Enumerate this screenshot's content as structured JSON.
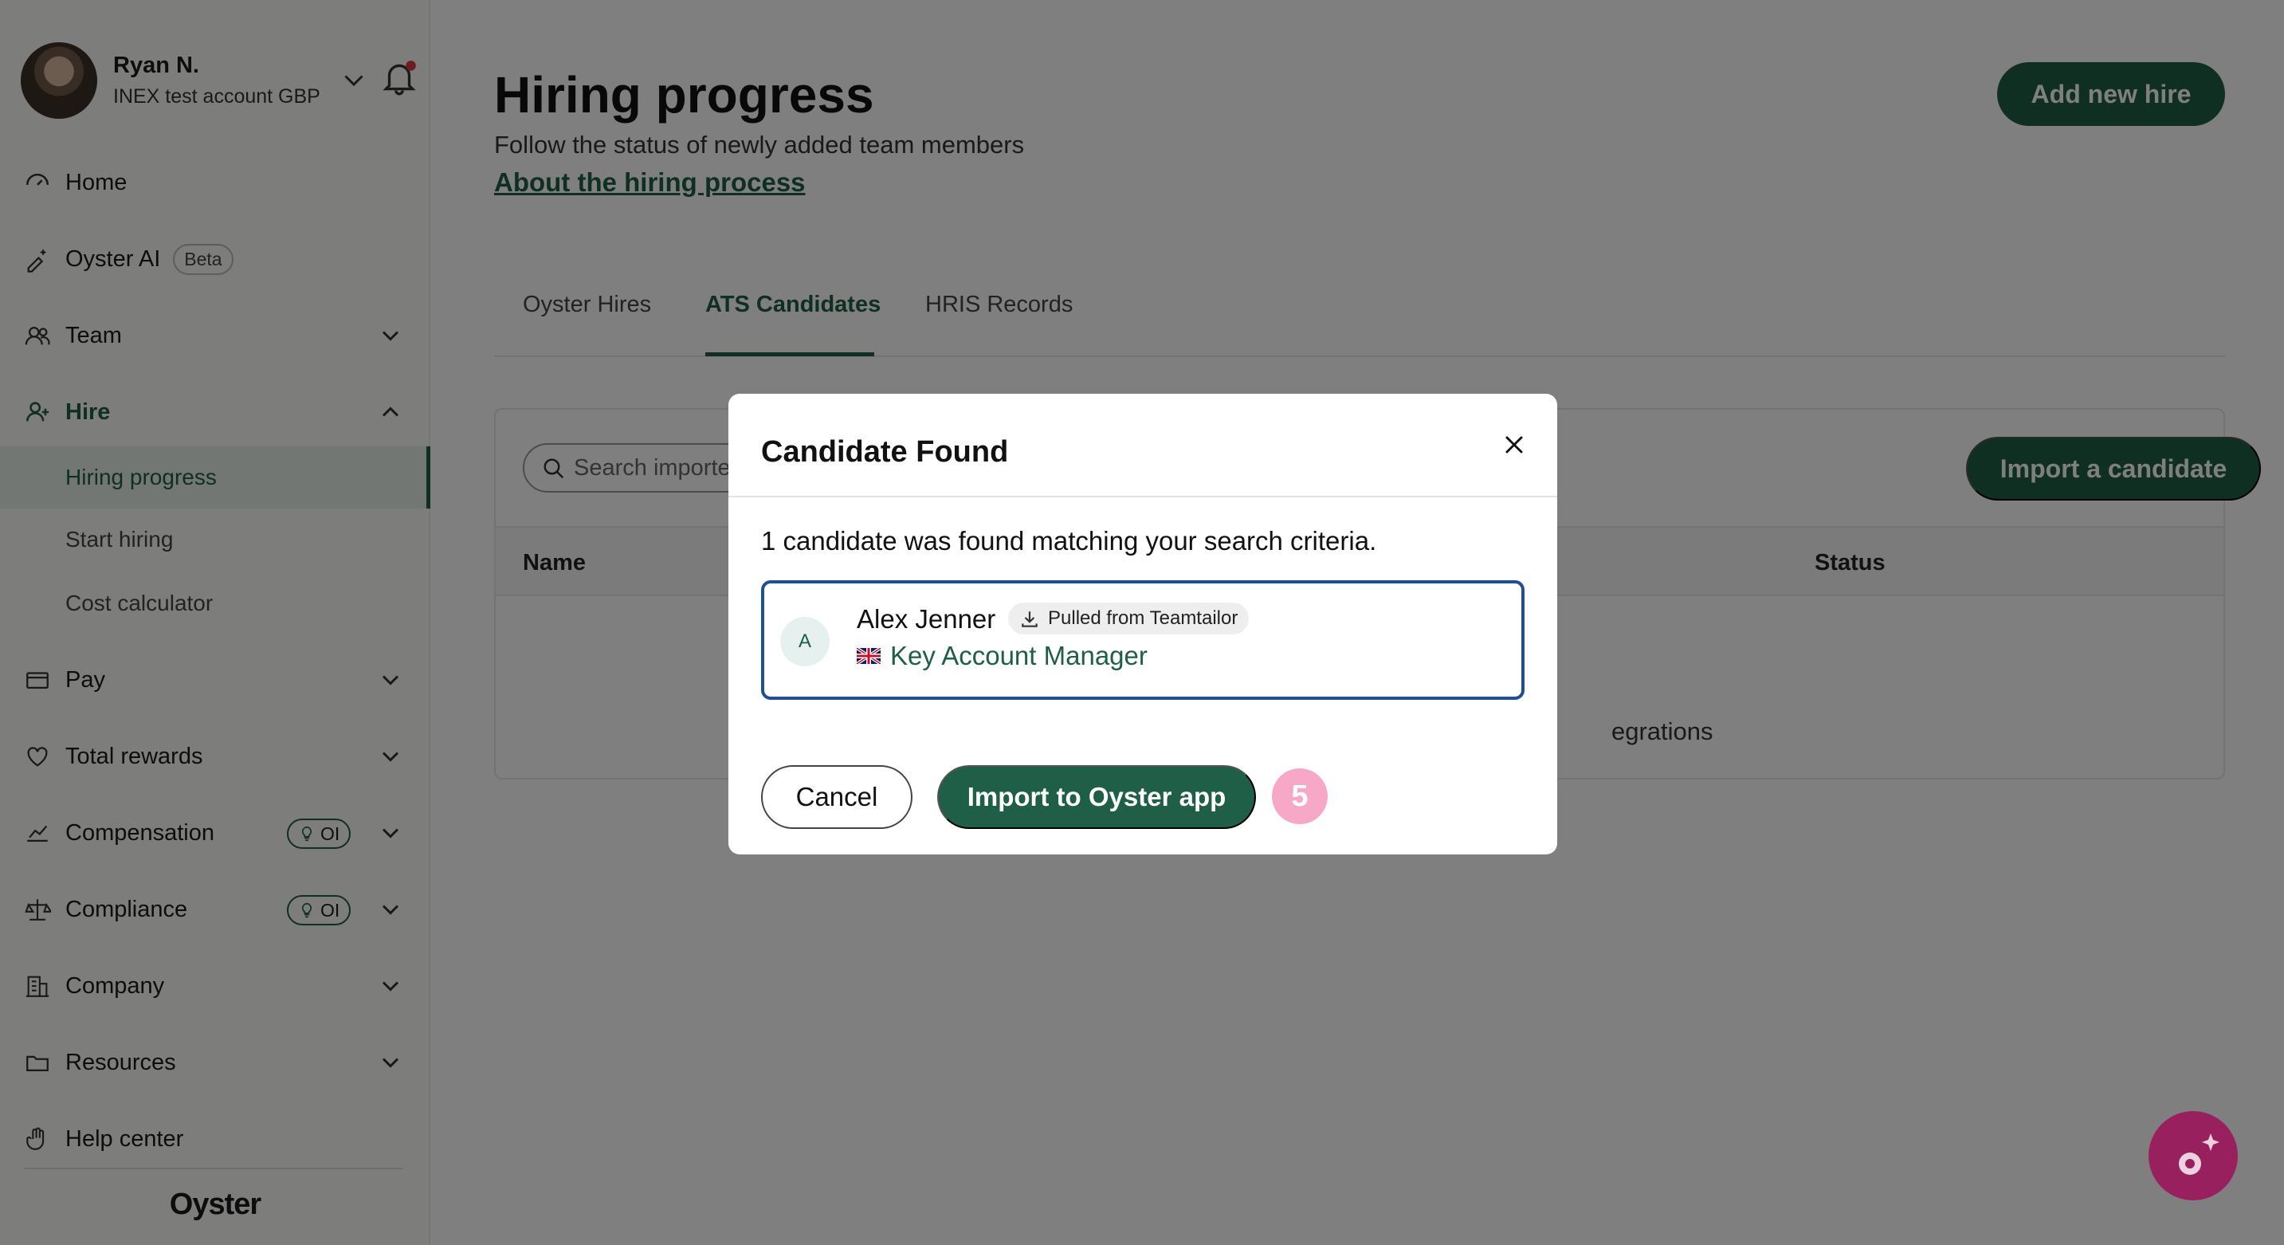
{
  "sidebar": {
    "profile": {
      "name": "Ryan N.",
      "account": "INEX test account GBP"
    },
    "items": [
      {
        "label": "Home",
        "icon": "home-icon"
      },
      {
        "label": "Oyster AI",
        "icon": "sparkle-pen-icon",
        "badge": "Beta"
      },
      {
        "label": "Team",
        "icon": "team-icon"
      },
      {
        "label": "Hire",
        "icon": "add-user-icon"
      },
      {
        "label": "Pay",
        "icon": "card-icon"
      },
      {
        "label": "Total rewards",
        "icon": "heart-icon"
      },
      {
        "label": "Compensation",
        "icon": "chart-icon",
        "badge": "OI"
      },
      {
        "label": "Compliance",
        "icon": "scales-icon",
        "badge": "OI"
      },
      {
        "label": "Company",
        "icon": "building-icon"
      },
      {
        "label": "Resources",
        "icon": "folder-icon"
      },
      {
        "label": "Help center",
        "icon": "hand-icon"
      }
    ],
    "hire_subitems": [
      {
        "label": "Hiring progress"
      },
      {
        "label": "Start hiring"
      },
      {
        "label": "Cost calculator"
      }
    ],
    "logo": "Oyster"
  },
  "header": {
    "title": "Hiring progress",
    "subtitle": "Follow the status of newly added team members",
    "link": "About the hiring process",
    "add_button": "Add new hire"
  },
  "tabs": [
    {
      "label": "Oyster Hires"
    },
    {
      "label": "ATS Candidates"
    },
    {
      "label": "HRIS Records"
    }
  ],
  "panel": {
    "search_placeholder": "Search imported",
    "import_button": "Import a candidate",
    "columns": [
      "Name",
      "Status"
    ],
    "empty_text_fragment": "egrations"
  },
  "modal": {
    "title": "Candidate Found",
    "message": "1 candidate was found matching your search criteria.",
    "candidate": {
      "initial": "A",
      "name": "Alex Jenner",
      "badge": "Pulled from Teamtailor",
      "role": "Key Account Manager"
    },
    "cancel": "Cancel",
    "confirm": "Import to Oyster app"
  },
  "step_badge": "5",
  "colors": {
    "brand": "#1f5e47",
    "card_border": "#1d4f91",
    "step_badge": "#f7a8c7"
  }
}
